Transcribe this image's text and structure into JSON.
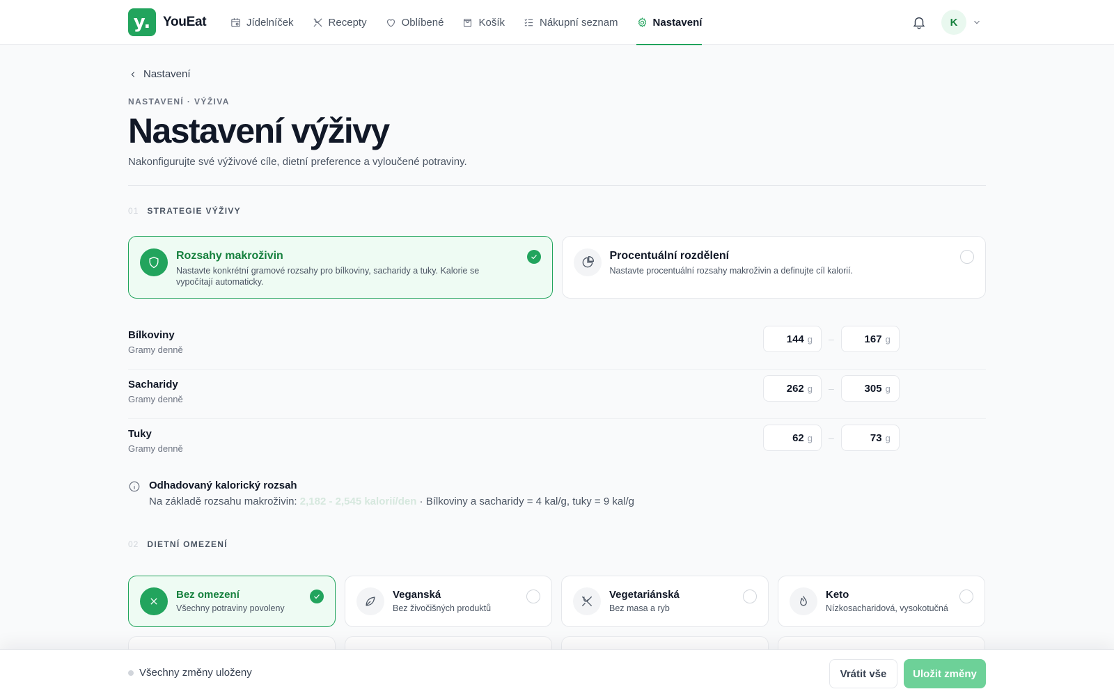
{
  "app": {
    "logo_letter": "y.",
    "name": "YouEat"
  },
  "nav": {
    "items": [
      {
        "label": "Jídelníček",
        "icon": "calendar-icon"
      },
      {
        "label": "Recepty",
        "icon": "utensils-icon"
      },
      {
        "label": "Oblíbené",
        "icon": "heart-icon"
      },
      {
        "label": "Košík",
        "icon": "bag-icon"
      },
      {
        "label": "Nákupní seznam",
        "icon": "checklist-icon"
      },
      {
        "label": "Nastavení",
        "icon": "gear-icon",
        "active": true
      }
    ]
  },
  "user": {
    "initial": "K"
  },
  "page": {
    "back_label": "Nastavení",
    "eyebrow": "NASTAVENÍ · VÝŽIVA",
    "title": "Nastavení výživy",
    "subtitle": "Nakonfigurujte své výživové cíle, dietní preference a vyloučené potraviny."
  },
  "strategy": {
    "number": "01",
    "heading": "STRATEGIE VÝŽIVY",
    "options": [
      {
        "title": "Rozsahy makroživin",
        "desc": "Nastavte konkrétní gramové rozsahy pro bílkoviny, sacharidy a tuky. Kalorie se vypočítají automaticky.",
        "selected": true,
        "icon": "shield-icon"
      },
      {
        "title": "Procentuální rozdělení",
        "desc": "Nastavte procentuální rozsahy makroživin a definujte cíl kalorií.",
        "selected": false,
        "icon": "pie-chart-icon"
      }
    ]
  },
  "macros": {
    "unit": "g",
    "rows": [
      {
        "name": "Bílkoviny",
        "sub": "Gramy denně",
        "min": "144",
        "max": "167"
      },
      {
        "name": "Sacharidy",
        "sub": "Gramy denně",
        "min": "262",
        "max": "305"
      },
      {
        "name": "Tuky",
        "sub": "Gramy denně",
        "min": "62",
        "max": "73"
      }
    ],
    "separator": "–"
  },
  "calories": {
    "heading": "Odhadovaný kalorický rozsah",
    "prefix": "Na základě rozsahu makroživin: ",
    "range": "2,182 - 2,545 kalorií/den",
    "suffix": " · Bílkoviny a sacharidy = 4 kal/g, tuky = 9 kal/g"
  },
  "diet": {
    "number": "02",
    "heading": "DIETNÍ OMEZENÍ",
    "options": [
      {
        "title": "Bez omezení",
        "desc": "Všechny potraviny povoleny",
        "selected": true,
        "icon": "x-icon"
      },
      {
        "title": "Veganská",
        "desc": "Bez živočišných produktů",
        "selected": false,
        "icon": "leaf-icon"
      },
      {
        "title": "Vegetariánská",
        "desc": "Bez masa a ryb",
        "selected": false,
        "icon": "no-meat-icon"
      },
      {
        "title": "Keto",
        "desc": "Nízkosacharidová, vysokotučná",
        "selected": false,
        "icon": "flame-icon"
      }
    ]
  },
  "footer": {
    "status": "Všechny změny uloženy",
    "reset_label": "Vrátit vše",
    "save_label": "Uložit změny"
  },
  "colors": {
    "accent": "#22a45d",
    "accent_light": "#eefbf3",
    "save_button": "#6dd198"
  }
}
